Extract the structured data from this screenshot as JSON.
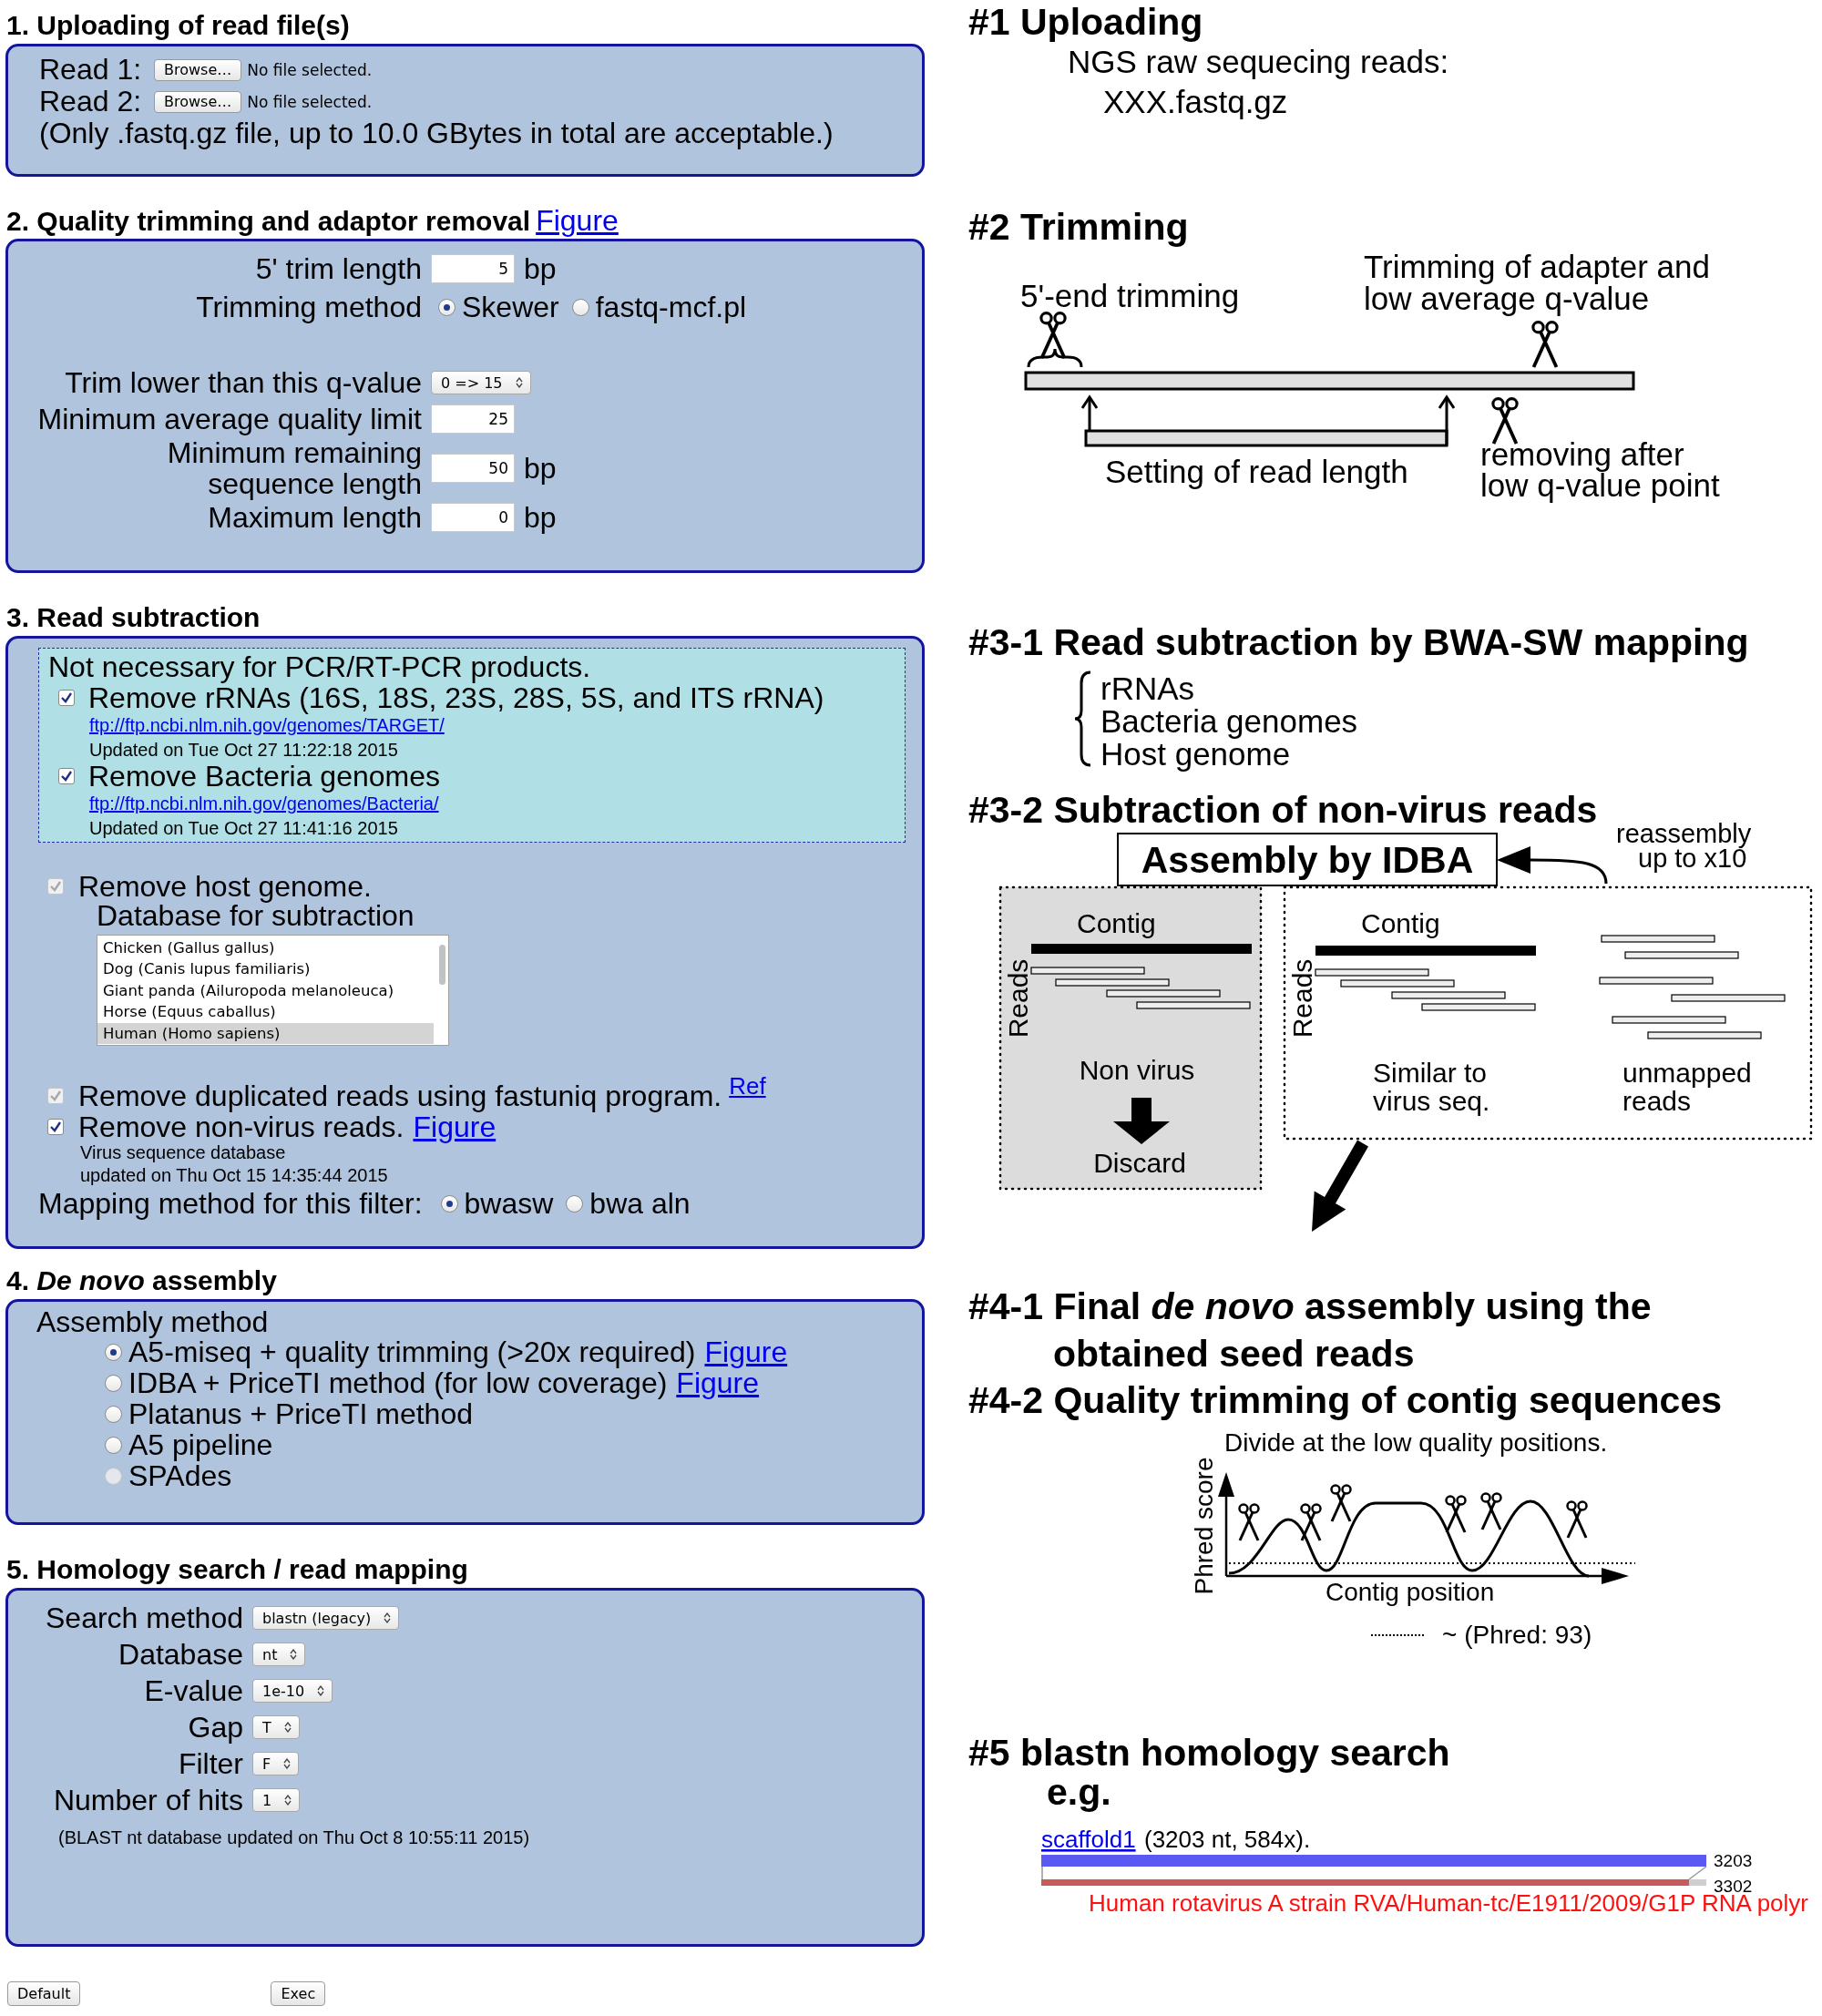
{
  "upload": {
    "heading": "1. Uploading of read file(s)",
    "reads": [
      {
        "label": "Read 1:",
        "button": "Browse…",
        "status": "No file selected."
      },
      {
        "label": "Read 2:",
        "button": "Browse…",
        "status": "No file selected."
      }
    ],
    "note": "(Only .fastq.gz file, up to 10.0 GBytes in total are acceptable.)"
  },
  "trimming": {
    "heading": "2. Quality trimming and adaptor removal",
    "link": "Figure",
    "fields": [
      {
        "kind": "number",
        "label": "5' trim length",
        "value": "5",
        "unit": "bp"
      },
      {
        "kind": "radio",
        "label": "Trimming method",
        "options": [
          {
            "label": "Skewer",
            "selected": true
          },
          {
            "label": "fastq-mcf.pl",
            "selected": false
          }
        ]
      },
      {
        "kind": "select",
        "label": "Trim lower than this q-value",
        "value": "0 => 15"
      },
      {
        "kind": "number",
        "label": "Minimum average quality limit",
        "value": "25"
      },
      {
        "kind": "number",
        "label": "Minimum remaining\nsequence length",
        "value": "50",
        "unit": "bp"
      },
      {
        "kind": "number",
        "label": "Maximum length",
        "value": "0",
        "unit": "bp"
      }
    ]
  },
  "subtraction": {
    "heading": "3. Read subtraction",
    "optional": {
      "note": "Not necessary for PCR/RT-PCR products.",
      "items": [
        {
          "label": "Remove rRNAs (16S, 18S, 23S, 28S, 5S, and ITS rRNA)",
          "checked": true,
          "link": "ftp://ftp.ncbi.nlm.nih.gov/genomes/TARGET/",
          "updated": "Updated on Tue Oct 27 11:22:18 2015"
        },
        {
          "label": "Remove Bacteria genomes",
          "checked": true,
          "link": "ftp://ftp.ncbi.nlm.nih.gov/genomes/Bacteria/",
          "updated": "Updated on Tue Oct 27 11:41:16 2015"
        }
      ]
    },
    "host": {
      "label": "Remove host genome.",
      "checked": true,
      "disabled": true,
      "db_label": "Database for subtraction",
      "db_options": [
        {
          "label": "Chicken (Gallus gallus)",
          "selected": false
        },
        {
          "label": "Dog (Canis lupus familiaris)",
          "selected": false
        },
        {
          "label": "Giant panda (Ailuropoda melanoleuca)",
          "selected": false
        },
        {
          "label": "Horse (Equus caballus)",
          "selected": false
        },
        {
          "label": "Human (Homo sapiens)",
          "selected": true
        }
      ]
    },
    "dedup": {
      "label": "Remove duplicated reads using fastuniq program.",
      "link": "Ref",
      "checked": true,
      "disabled": true
    },
    "nonvirus": {
      "label": "Remove non-virus reads.",
      "link": "Figure",
      "checked": true,
      "disabled": false,
      "db_note": [
        "Virus sequence database",
        "updated on Thu Oct 15 14:35:44 2015"
      ]
    },
    "mapping": {
      "label": "Mapping method for this filter:",
      "options": [
        {
          "label": "bwasw",
          "selected": true
        },
        {
          "label": "bwa aln",
          "selected": false
        }
      ]
    }
  },
  "assembly": {
    "heading": "4. *De novo* assembly",
    "label": "Assembly method",
    "options": [
      {
        "label": "A5-miseq + quality trimming (>20x required)",
        "link": "Figure",
        "selected": true,
        "disabled": false
      },
      {
        "label": "IDBA + PriceTI method (for low coverage)",
        "link": "Figure",
        "selected": false,
        "disabled": false
      },
      {
        "label": "Platanus + PriceTI method",
        "selected": false,
        "disabled": false
      },
      {
        "label": "A5 pipeline",
        "selected": false,
        "disabled": false
      },
      {
        "label": "SPAdes",
        "selected": false,
        "disabled": true
      }
    ]
  },
  "homology": {
    "heading": "5. Homology search / read mapping",
    "fields": [
      {
        "label": "Search method",
        "value": "blastn (legacy)"
      },
      {
        "label": "Database",
        "value": "nt"
      },
      {
        "label": "E-value",
        "value": "1e-10"
      },
      {
        "label": "Gap",
        "value": "T"
      },
      {
        "label": "Filter",
        "value": "F"
      },
      {
        "label": "Number of hits",
        "value": "1"
      }
    ],
    "note": "(BLAST nt database updated on Thu Oct 8 10:55:11 2015)"
  },
  "buttons": [
    "Default",
    "Exec"
  ],
  "figure": {
    "upload": {
      "heading": "#1 Uploading",
      "lines": [
        "NGS raw sequecing reads:",
        "XXX.fastq.gz"
      ]
    },
    "trimming": {
      "heading": "#2 Trimming",
      "five_prime_label": "5'-end trimming",
      "adapter_label": [
        "Trimming of adapter and",
        "low average q-value"
      ],
      "read_length_label": "Setting of read length",
      "removal_label": [
        "removing after",
        "low q-value point"
      ]
    },
    "subtraction": {
      "heading": "#3-1 Read subtraction by BWA-SW mapping",
      "targets": [
        "rRNAs",
        "Bacteria genomes",
        "Host genome"
      ]
    },
    "filter": {
      "heading": "#3-2 Subtraction of non-virus reads",
      "assembler": "Assembly by IDBA",
      "loop_label": [
        "reassembly",
        "up to x10"
      ],
      "discard_panel": {
        "contig": "Contig",
        "axis": "Reads",
        "caption": "Non virus",
        "result": "Discard"
      },
      "keep_panel": {
        "contig": "Contig",
        "axis": "Reads",
        "mapped_caption": [
          "Similar to",
          "virus seq."
        ],
        "unmapped_caption": [
          "unmapped",
          "reads"
        ]
      }
    },
    "assembly": {
      "heading": "#4-1 Final *de novo* assembly using the",
      "heading_cont": "obtained seed reads",
      "trim_heading": "#4-2 Quality trimming of contig sequences",
      "caption": "Divide at the low quality positions.",
      "y_label": "Phred score",
      "x_label": "Contig position",
      "legend": "~ (Phred: 93)"
    },
    "blast": {
      "heading": "#5 blastn homology search",
      "example": "e.g.",
      "query_link": "scaffold1",
      "query_info": "(3203 nt, 584x).",
      "query_length": "3203",
      "hit_length": "3302",
      "hit_description": "Human rotavirus A strain RVA/Human-tc/E1911/2009/G1P RNA polyr"
    }
  }
}
